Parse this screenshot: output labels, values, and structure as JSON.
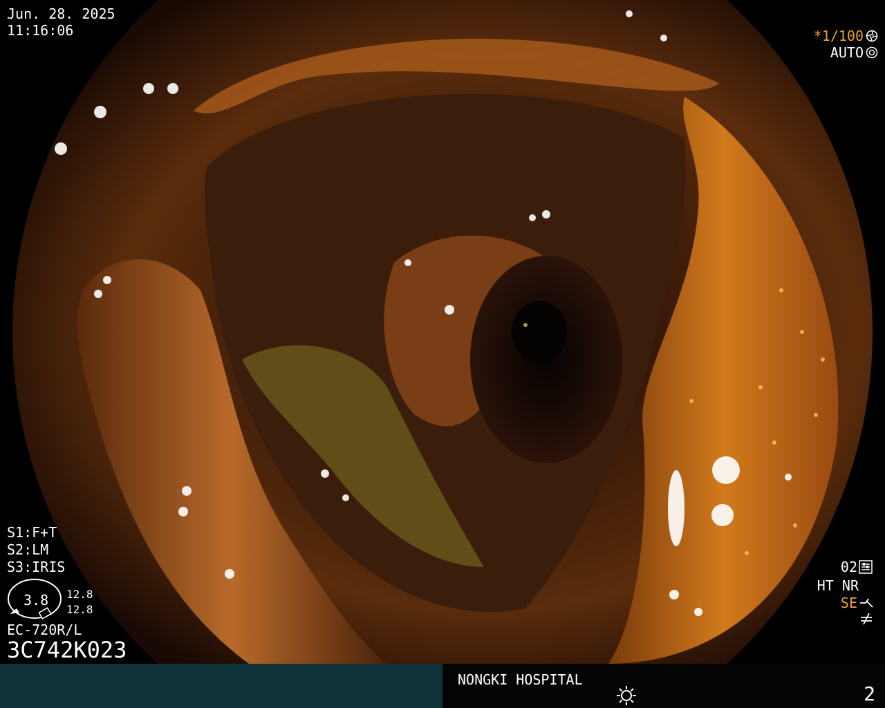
{
  "overlay": {
    "date": "Jun. 28. 2025",
    "time": "11:16:06",
    "shutter": "*1/100",
    "exposure_mode": "AUTO",
    "switches": [
      "S1:F+T",
      "S2:LM",
      "S3:IRIS"
    ],
    "gauge_value": "3.8",
    "gauge_top": "12.8",
    "gauge_bottom": "12.8",
    "scope_model": "EC-720R/L",
    "serial": "3C742K023",
    "preset": "02",
    "mode_labels": "HT NR",
    "se_label": "SE"
  },
  "footer": {
    "hospital": "NONGKI HOSPITAL",
    "page_number": "2"
  },
  "icons": [
    "shutter-icon",
    "auto-iris-icon",
    "settings-icon",
    "curve-icon",
    "not-equal-icon",
    "brightness-icon",
    "scope-tip-gauge-icon"
  ]
}
